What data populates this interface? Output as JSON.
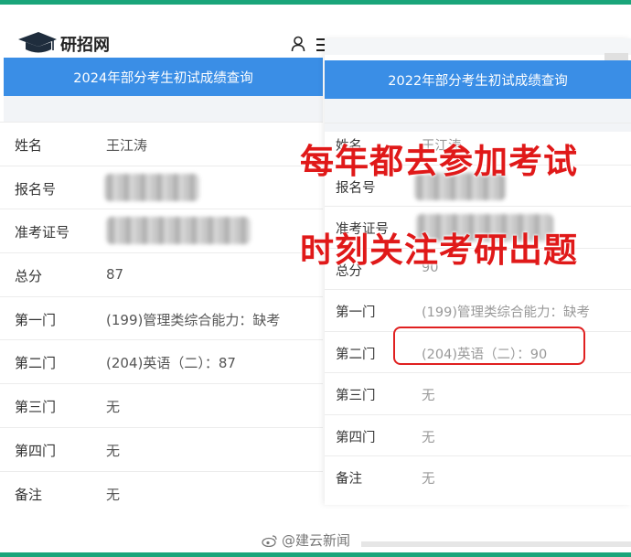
{
  "brand": {
    "name": "研招网"
  },
  "icons": {
    "logo": "graduation-cap-icon",
    "user": "user-icon",
    "menu": "hamburger-menu-icon",
    "watermark": "weibo-icon"
  },
  "colors": {
    "header_bar": "#3a8ee6",
    "overlay_text": "#e01919",
    "frame": "#1aa57a"
  },
  "left_card": {
    "title": "2024年部分考生初试成绩查询",
    "rows": [
      {
        "label": "姓名",
        "value": "王江涛"
      },
      {
        "label": "报名号",
        "value": ""
      },
      {
        "label": "准考证号",
        "value": ""
      },
      {
        "label": "总分",
        "value": "87"
      },
      {
        "label": "第一门",
        "value": "(199)管理类综合能力：缺考"
      },
      {
        "label": "第二门",
        "value": "(204)英语（二）：87"
      },
      {
        "label": "第三门",
        "value": "无"
      },
      {
        "label": "第四门",
        "value": "无"
      },
      {
        "label": "备注",
        "value": "无"
      }
    ]
  },
  "right_card": {
    "title": "2022年部分考生初试成绩查询",
    "rows": [
      {
        "label": "姓名",
        "value": "王江涛"
      },
      {
        "label": "报名号",
        "value": ""
      },
      {
        "label": "准考证号",
        "value": ""
      },
      {
        "label": "总分",
        "value": "90"
      },
      {
        "label": "第一门",
        "value": "(199)管理类综合能力：缺考"
      },
      {
        "label": "第二门",
        "value": "(204)英语（二）：90"
      },
      {
        "label": "第三门",
        "value": "无"
      },
      {
        "label": "第四门",
        "value": "无"
      },
      {
        "label": "备注",
        "value": "无"
      }
    ]
  },
  "overlay": {
    "line1": "每年都去参加考试",
    "line2": "时刻关注考研出题"
  },
  "watermark": {
    "text": "@建云新闻"
  }
}
